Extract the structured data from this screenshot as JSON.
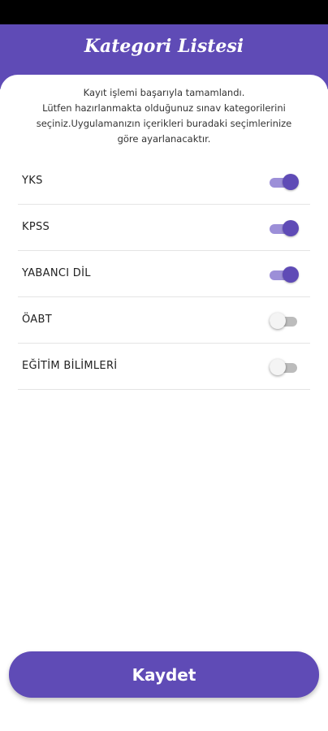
{
  "header": {
    "title": "Kategori Listesi"
  },
  "intro": {
    "line1": "Kayıt işlemi başarıyla tamamlandı.",
    "line2": "Lütfen hazırlanmakta olduğunuz sınav kategorilerini",
    "line3": "seçiniz.Uygulamanızın içerikleri buradaki seçimlerinize",
    "line4": "göre ayarlanacaktır."
  },
  "categories": [
    {
      "label": "YKS",
      "enabled": true
    },
    {
      "label": "KPSS",
      "enabled": true
    },
    {
      "label": "YABANCI DİL",
      "enabled": true
    },
    {
      "label": "ÖABT",
      "enabled": false
    },
    {
      "label": "EĞİTİM BİLİMLERİ",
      "enabled": false
    }
  ],
  "save_button": {
    "label": "Kaydet"
  },
  "colors": {
    "accent": "#5f4bb6",
    "toggle_on_track": "#9c8fd8",
    "toggle_off_track": "#bcbcbc"
  }
}
